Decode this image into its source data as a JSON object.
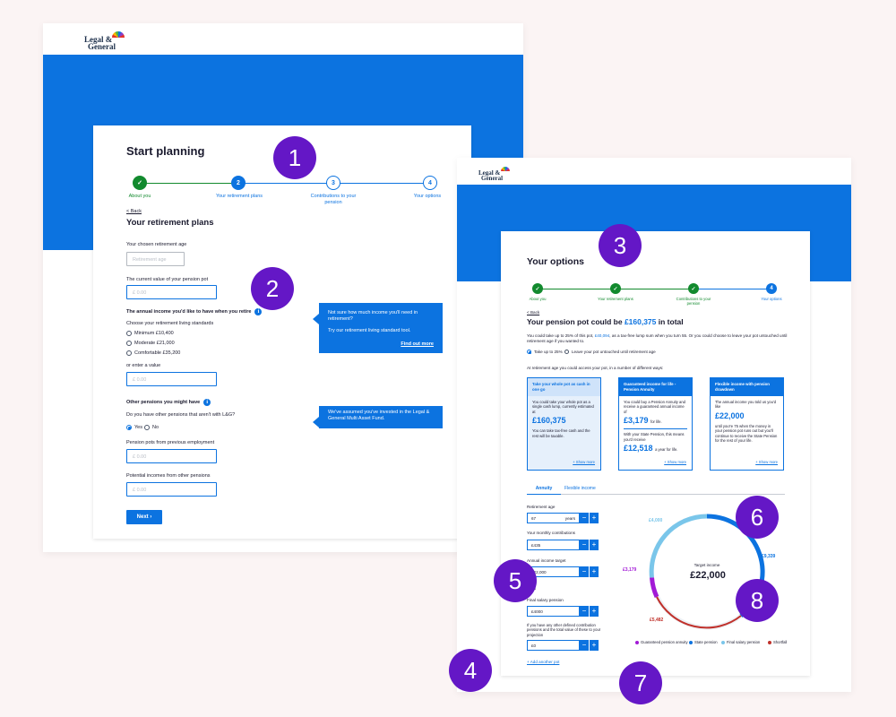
{
  "brand": {
    "line1": "Legal &",
    "line2": "General",
    "blue": "#0c73e0",
    "purple": "#6417c6",
    "green": "#128a2e"
  },
  "left": {
    "title": "Start planning",
    "steps": [
      {
        "num": "✓",
        "label": "About you"
      },
      {
        "num": "2",
        "label": "Your retirement plans"
      },
      {
        "num": "3",
        "label": "Contributions to your pension"
      },
      {
        "num": "4",
        "label": "Your options"
      }
    ],
    "back": "< Back",
    "section_title": "Your retirement plans",
    "age_label": "Your chosen retirement age",
    "age_placeholder": "Retirement age",
    "pot_label": "The current value of your pension pot",
    "pot_placeholder": "£ 0.00",
    "income_label": "The annual income you'd like to have when you retire",
    "standards_label": "Choose your retirement living standards",
    "standards": [
      "Minimum £10,400",
      "Moderate £21,000",
      "Comfortable £35,200"
    ],
    "enter_value": "or enter a value",
    "value_placeholder": "£ 0.00",
    "other_title": "Other pensions you might have",
    "other_q": "Do you have other pensions that aren't with L&G?",
    "yes": "Yes",
    "no": "No",
    "prev_label": "Pension pots from previous employment",
    "prev_placeholder": "£ 0.00",
    "potential_label": "Potential incomes from other pensions",
    "potential_placeholder": "£ 0.00",
    "next": "Next",
    "tip1_text": "Not sure how much income you'll need in retirement?",
    "tip1_text2": "Try our retirement living standard tool.",
    "tip1_link": "Find out more",
    "tip2_text": "We've assumed you've invested in the Legal & General Multi Asset Fund."
  },
  "right": {
    "title": "Your options",
    "steps": [
      {
        "num": "✓",
        "label": "About you"
      },
      {
        "num": "✓",
        "label": "Your retirement plans"
      },
      {
        "num": "✓",
        "label": "Contributions to your pension"
      },
      {
        "num": "4",
        "label": "Your options"
      }
    ],
    "back": "< Back",
    "headline_pre": "Your pension pot could be ",
    "headline_amount": "£160,375",
    "headline_post": " in total",
    "intro_pre": "You could take up to 25% of this pot, ",
    "intro_amount": "£40,094",
    "intro_post": ", as a tax-free lump sum when you turn 55. Or you could choose to leave your pot untouched until retirement age if you wanted to.",
    "radio1": "Take up to 25%",
    "radio2": "Leave your pot untouched until retirement age",
    "access_text": "At retirement age you could access your pot, in a number of different ways:",
    "options": [
      {
        "head": "Take your whole pot as cash in one go",
        "body": "You could take your whole pot as a single cash lump, currently estimated at",
        "amount": "£160,375",
        "suffix": "",
        "body2": "You can take tax-free cash and the rest will be taxable.",
        "amount2": "",
        "suffix2": "",
        "more": "+ Show more"
      },
      {
        "head": "Guaranteed income for life - Pension Annuity",
        "body": "You could buy a Pension Annuity and receive a guaranteed annual income of",
        "amount": "£3,179",
        "suffix": "for life.",
        "body2": "With your State Pension, this means you'd receive",
        "amount2": "£12,518",
        "suffix2": "a year for life.",
        "more": "+ Show more"
      },
      {
        "head": "Flexible income with pension drawdown",
        "body": "The annual income you told us you'd like",
        "amount": "£22,000",
        "suffix": "",
        "body2": "until you're 75 when the money in your pension pot runs out but you'll continue to receive the State Pension for the rest of your life.",
        "amount2": "",
        "suffix2": "",
        "more": "+ Show more"
      }
    ],
    "tabs": [
      "Annuity",
      "Flexible income"
    ],
    "fields": [
      {
        "label": "Retirement age",
        "value": "67",
        "unit": "years"
      },
      {
        "label": "Your monthly contributions",
        "value": "£435",
        "unit": ""
      },
      {
        "label": "Annual income target",
        "value": "£22,000",
        "unit": ""
      },
      {
        "label": "Final salary pension",
        "value": "£4000",
        "unit": ""
      },
      {
        "label": "If you have any other defined contribution pensions and the total value of these to your projection",
        "value": "£0",
        "unit": ""
      }
    ],
    "pots_label": "Pots",
    "add_pot": "+ Add another pot",
    "minus": "−",
    "plus": "+",
    "target_label": "Target income",
    "target_value": "£22,000",
    "ring_labels": {
      "final": "£4,000",
      "state": "£9,339",
      "guaranteed": "£3,179",
      "shortfall": "£5,482"
    },
    "legend": [
      {
        "label": "Guaranteed pension annuity",
        "color": "#a21ad6"
      },
      {
        "label": "State pension",
        "color": "#0c73e0"
      },
      {
        "label": "Final salary pension",
        "color": "#7ac6ea"
      },
      {
        "label": "Shortfall",
        "color": "#c0312b"
      }
    ]
  },
  "badges": [
    "1",
    "2",
    "3",
    "4",
    "5",
    "6",
    "7",
    "8"
  ]
}
